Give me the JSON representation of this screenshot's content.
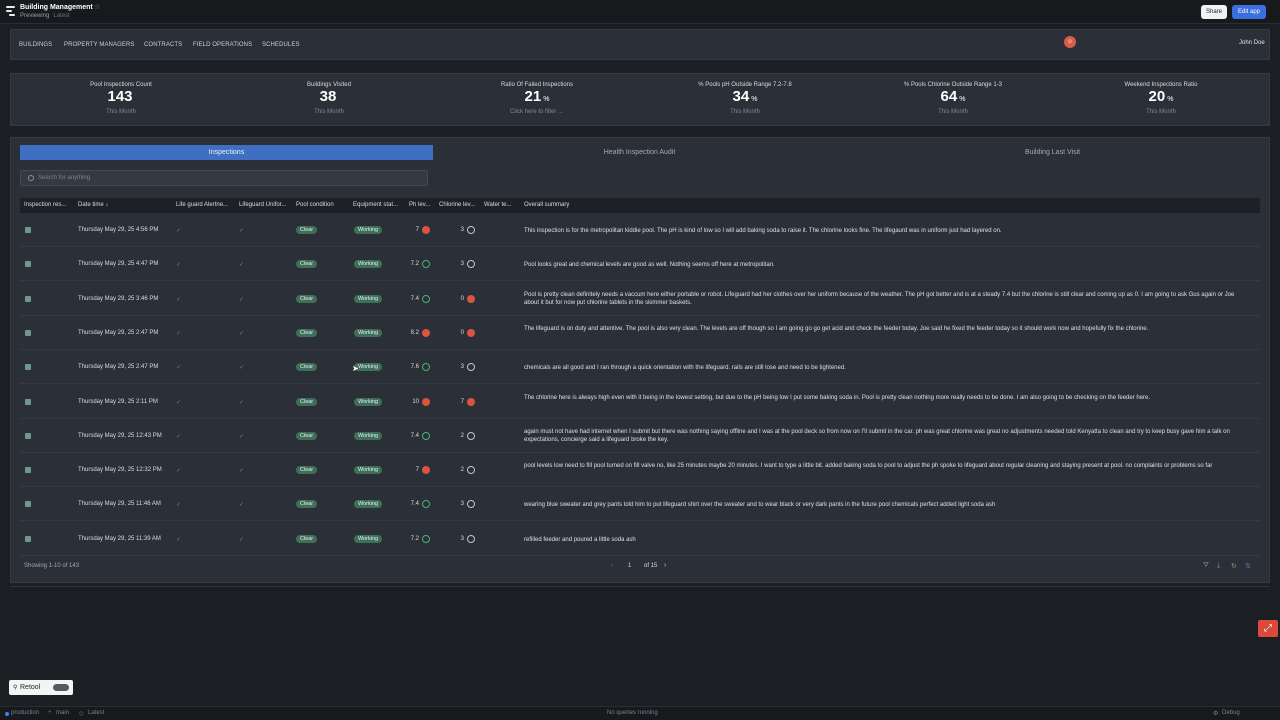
{
  "app": {
    "title": "Building Management",
    "mode": "Previewing",
    "version": "Latest",
    "share_label": "Share",
    "edit_label": "Edit app"
  },
  "nav": {
    "items": [
      "BUILDINGS",
      "PROPERTY MANAGERS",
      "CONTRACTS",
      "FIELD OPERATIONS",
      "SCHEDULES"
    ],
    "user": "John Doe",
    "avatar_icon": "smiley-icon"
  },
  "stats": [
    {
      "label": "Pool Inspections Count",
      "value": "143",
      "unit": "",
      "note": "This Month"
    },
    {
      "label": "Buildings Visited",
      "value": "38",
      "unit": "",
      "note": "This Month"
    },
    {
      "label": "Ratio Of Failed Inspections",
      "value": "21",
      "unit": "%",
      "note": "Click here to filter →"
    },
    {
      "label": "% Pools pH Outside Range 7.2-7.8",
      "value": "34",
      "unit": "%",
      "note": "This Month"
    },
    {
      "label": "% Pools Chlorine Outside Range 1-3",
      "value": "64",
      "unit": "%",
      "note": "This Month"
    },
    {
      "label": "Weekend Inspections Ratio",
      "value": "20",
      "unit": "%",
      "note": "This Month"
    }
  ],
  "tabs": [
    "Inspections",
    "Health Inspection Audit",
    "Building Last Visit"
  ],
  "search": {
    "placeholder": "Search for anything"
  },
  "table": {
    "columns": [
      "Inspection res...",
      "Date time ↓",
      "Life guard Alertne...",
      "Lifeguard Unifor...",
      "Pool condition",
      "Equipment stat...",
      "Ph lev...",
      "Chlorine lev...",
      "Water te...",
      "Overall summary"
    ],
    "rows": [
      {
        "date": "Thursday May 29, 25 4:56 PM",
        "pool": "Clear",
        "equip": "Working",
        "ph": "7",
        "ph_status": "bad",
        "cl": "3",
        "cl_status": "neutral",
        "summary": "This inspection is for the metropolitan kiddie pool. The pH is kind of low so I will add baking soda to raise it. The chlorine looks fine. The lifegaurd was in uniform just had layered on."
      },
      {
        "date": "Thursday May 29, 25 4:47 PM",
        "pool": "Clear",
        "equip": "Working",
        "ph": "7.2",
        "ph_status": "good",
        "cl": "3",
        "cl_status": "neutral",
        "summary": "Pool looks great and chemical levels are good as well. Nothing seems off here at metropolitan."
      },
      {
        "date": "Thursday May 29, 25 3:46 PM",
        "pool": "Clear",
        "equip": "Working",
        "ph": "7.4",
        "ph_status": "good",
        "cl": "0",
        "cl_status": "bad",
        "summary": "Pool is pretty clean definitely needs a vaccum here either portable or robot. Lifeguard had her clothes over her uniform because of the weather. The pH got better and is at a steady 7.4 but the chlorine is still clear and coming up as 0. I am going to ask Gus again or Joe about it but for now put chlorine tablets in the skimmer baskets."
      },
      {
        "date": "Thursday May 29, 25 2:47 PM",
        "pool": "Clear",
        "equip": "Working",
        "ph": "8.2",
        "ph_status": "bad",
        "cl": "0",
        "cl_status": "bad",
        "summary": "The lifeguard is on duty and attentive. The pool is also very clean. The levels are off though so I am going go go get acid and check the feeder today. Joe said he fixed the feeder today so it should work now and hopefully fix the chlorine."
      },
      {
        "date": "Thursday May 29, 25 2:47 PM",
        "pool": "Clear",
        "equip": "Working",
        "ph": "7.6",
        "ph_status": "good",
        "cl": "3",
        "cl_status": "neutral",
        "summary": "chemicals are all good and I ran through a quick orientation with the lifeguard. rails are still lose and need to be tightened."
      },
      {
        "date": "Thursday May 29, 25 2:11 PM",
        "pool": "Clear",
        "equip": "Working",
        "ph": "10",
        "ph_status": "bad",
        "cl": "7",
        "cl_status": "bad",
        "summary": "The chlorine here is always high even with it being in the lowest setting, but due to the pH being low I put some baking soda in. Pool is pretty clean nothing more really needs to be done. I am also going to be checking on the feeder here."
      },
      {
        "date": "Thursday May 29, 25 12:43 PM",
        "pool": "Clear",
        "equip": "Working",
        "ph": "7.4",
        "ph_status": "good",
        "cl": "2",
        "cl_status": "neutral",
        "summary": "again must not have had internet when I submit but there was nothing saying offline and I was at the pool deck so from now on I'll submit in the car. ph was great chlorine was great no adjustments needed told Kenyatta to clean and try to keep busy gave him a talk on expectations, concierge said a lifeguard broke the key."
      },
      {
        "date": "Thursday May 29, 25 12:32 PM",
        "pool": "Clear",
        "equip": "Working",
        "ph": "7",
        "ph_status": "bad",
        "cl": "2",
        "cl_status": "neutral",
        "summary": "pool levels low need to fill pool turned on fill valve no, like 25 minutes maybe 20 minutes. I want to type a little bit. added baking soda to pool to adjust the ph spoke to lifeguard about regular cleaning and staying present at pool. no complaints or problems so far"
      },
      {
        "date": "Thursday May 29, 25 11:46 AM",
        "pool": "Clear",
        "equip": "Working",
        "ph": "7.4",
        "ph_status": "good",
        "cl": "3",
        "cl_status": "neutral",
        "summary": "wearing blue sweater and grey pants told him to put lifeguard shirt over the sweater and to wear black or very dark pants in the future pool chemicals perfect added light soda ash"
      },
      {
        "date": "Thursday May 29, 25 11:39 AM",
        "pool": "Clear",
        "equip": "Working",
        "ph": "7.2",
        "ph_status": "good",
        "cl": "3",
        "cl_status": "neutral",
        "summary": "refilled feeder and poured a little soda ash"
      }
    ],
    "footer": "Showing 1-10 of 143",
    "page": "1",
    "page_total": "of 15"
  },
  "bottom": {
    "retool_label": "Retool",
    "env": "production",
    "branch": "main",
    "release": "Latest",
    "queries": "No queries running",
    "debug": "Debug"
  },
  "colors": {
    "accent": "#3e6fc2",
    "bad": "#d8553f",
    "good": "#49b36d",
    "tag": "#3f6f5b"
  }
}
